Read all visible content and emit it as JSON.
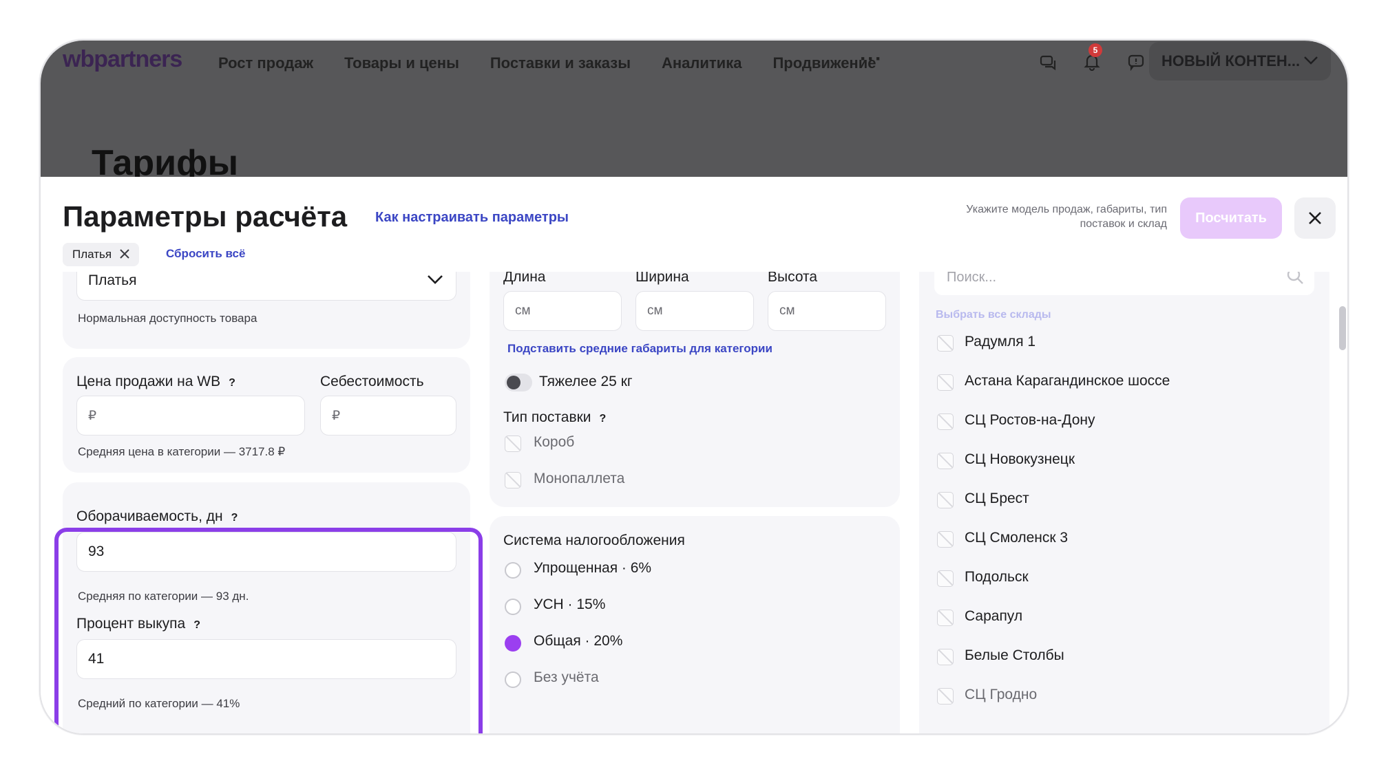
{
  "topnav": {
    "logo": "wbpartners",
    "items": [
      "Рост продаж",
      "Товары и цены",
      "Поставки и заказы",
      "Аналитика",
      "Продвижение"
    ],
    "more": "···",
    "notifications_count": "5",
    "account": "НОВЫЙ КОНТЕН..."
  },
  "page": {
    "title": "Тарифы"
  },
  "modal": {
    "title": "Параметры расчёта",
    "help_link": "Как настраивать параметры",
    "hint": "Укажите модель продаж, габариты, тип поставок и склад",
    "calculate_button": "Посчитать",
    "close_icon": "close-icon",
    "accent": "#8b3ee8"
  },
  "filters": {
    "chip_label": "Платья",
    "reset": "Сбросить всё"
  },
  "left": {
    "category_value": "Платья",
    "availability_note": "Нормальная доступность товара",
    "price_label": "Цена продажи на WB",
    "price_placeholder": "₽",
    "cost_label": "Себестоимость",
    "cost_placeholder": "₽",
    "avg_price_note": "Средняя цена в категории — 3717.8 ₽",
    "turnover_label": "Оборачиваемость, дн",
    "turnover_value": "93",
    "turnover_note": "Средняя по категории — 93 дн.",
    "buyout_label": "Процент выкупа",
    "buyout_value": "41",
    "buyout_note": "Средний по категории — 41%",
    "help_mark": "?"
  },
  "middle": {
    "length_label": "Длина",
    "width_label": "Ширина",
    "height_label": "Высота",
    "unit_placeholder": "см",
    "avg_dims_link": "Подставить средние габариты для категории",
    "heavy_toggle": "Тяжелее 25 кг",
    "supply_type_label": "Тип поставки",
    "supply_options": [
      "Короб",
      "Монопаллета"
    ],
    "tax_label": "Система налогообложения",
    "tax_options": [
      "Упрощенная · 6%",
      "УСН · 15%",
      "Общая · 20%",
      "Без учёта"
    ],
    "tax_selected": "Общая · 20%"
  },
  "right": {
    "search_placeholder": "Поиск...",
    "select_all": "Выбрать все склады",
    "warehouses": [
      "Радумля 1",
      "Астана Карагандинское шоссе",
      "СЦ Ростов-на-Дону",
      "СЦ Новокузнецк",
      "СЦ Брест",
      "СЦ Смоленск 3",
      "Подольск",
      "Сарапул",
      "Белые Столбы",
      "СЦ Гродно"
    ]
  }
}
